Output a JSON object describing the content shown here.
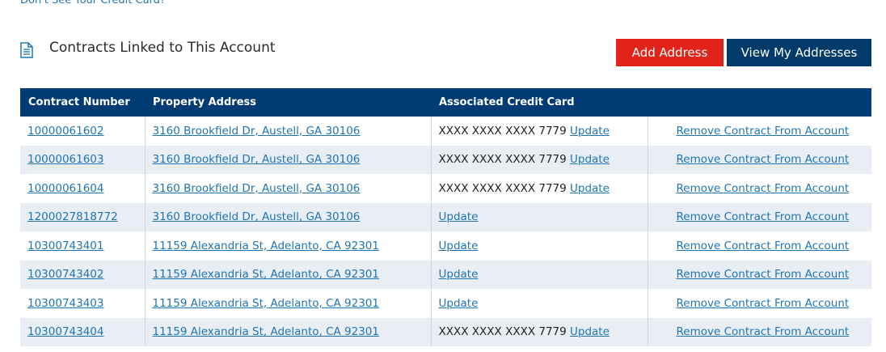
{
  "top_link": "Don't See Your Credit Card?",
  "section": {
    "title": "Contracts Linked to This Account",
    "icon": "document-icon",
    "add_address_label": "Add Address",
    "view_addresses_label": "View My Addresses"
  },
  "colors": {
    "link": "#1f75b4",
    "header_bg": "#003b73",
    "button_red": "#e2231a",
    "button_navy": "#023b69",
    "row_alt": "#e9eef5"
  },
  "table": {
    "columns": [
      "Contract Number",
      "Property Address",
      "Associated Credit Card",
      ""
    ],
    "rows": [
      {
        "contract": "10000061602",
        "address": "3160 Brookfield Dr, Austell, GA 30106",
        "card": "XXXX XXXX XXXX 7779",
        "update": "Update",
        "remove": "Remove Contract From Account"
      },
      {
        "contract": "10000061603",
        "address": "3160 Brookfield Dr, Austell, GA 30106",
        "card": "XXXX XXXX XXXX 7779",
        "update": "Update",
        "remove": "Remove Contract From Account"
      },
      {
        "contract": "10000061604",
        "address": "3160 Brookfield Dr, Austell, GA 30106",
        "card": "XXXX XXXX XXXX 7779",
        "update": "Update",
        "remove": "Remove Contract From Account"
      },
      {
        "contract": "1200027818772",
        "address": "3160 Brookfield Dr, Austell, GA 30106",
        "card": "",
        "update": "Update",
        "remove": "Remove Contract From Account"
      },
      {
        "contract": "10300743401",
        "address": "11159 Alexandria St, Adelanto, CA 92301",
        "card": "",
        "update": "Update",
        "remove": "Remove Contract From Account"
      },
      {
        "contract": "10300743402",
        "address": "11159 Alexandria St, Adelanto, CA 92301",
        "card": "",
        "update": "Update",
        "remove": "Remove Contract From Account"
      },
      {
        "contract": "10300743403",
        "address": "11159 Alexandria St, Adelanto, CA 92301",
        "card": "",
        "update": "Update",
        "remove": "Remove Contract From Account"
      },
      {
        "contract": "10300743404",
        "address": "11159 Alexandria St, Adelanto, CA 92301",
        "card": "XXXX XXXX XXXX 7779",
        "update": "Update",
        "remove": "Remove Contract From Account"
      }
    ]
  }
}
